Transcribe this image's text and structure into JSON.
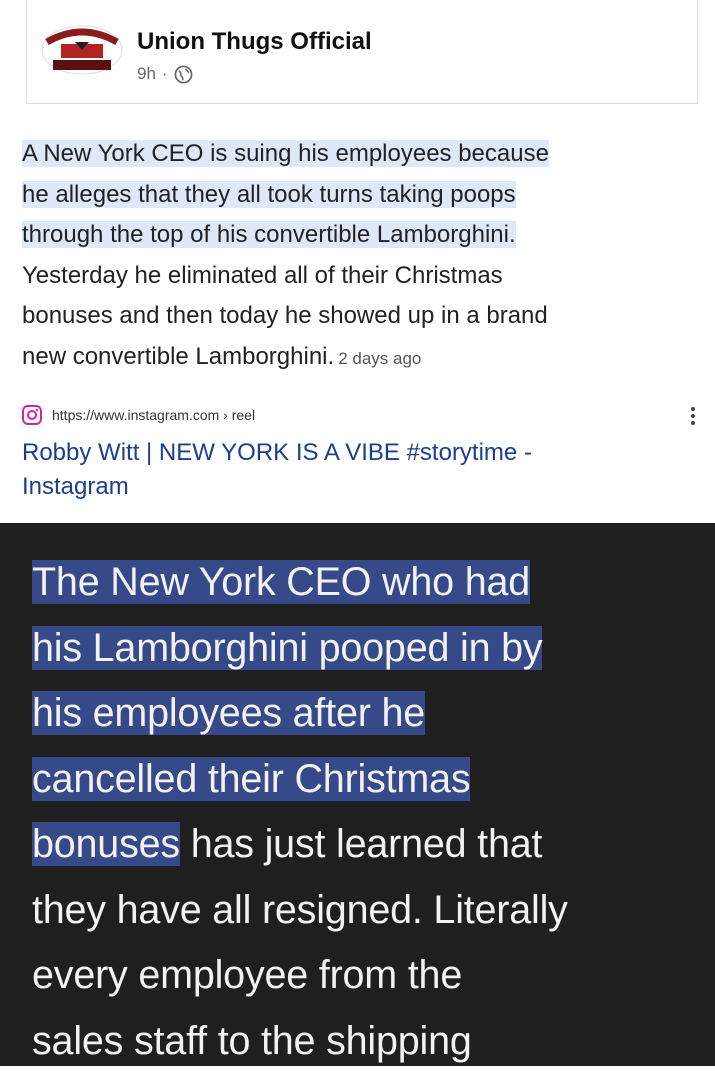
{
  "post": {
    "page_name": "Union Thugs Official",
    "time": "9h",
    "separator": "·",
    "avatar_logo_text": "UNION THUGS"
  },
  "snippet": {
    "lines": [
      "A New York CEO is suing his employees because",
      "he alleges that they all took turns taking poops",
      "through the top of his convertible Lamborghini.",
      "Yesterday he eliminated all of their Christmas",
      "bonuses and then today he showed up in a brand",
      "new convertible Lamborghini."
    ],
    "date": "2 days ago",
    "source_url": "https://www.instagram.com › reel",
    "result_title_line1": "Robby Witt | NEW YORK IS A VIBE #storytime -",
    "result_title_line2": "Instagram"
  },
  "dark_quote": {
    "lines_highlighted": [
      "The New York CEO who had",
      "his Lamborghini pooped in by",
      "his employees after he",
      "cancelled their Christmas",
      "bonuses"
    ],
    "line5_rest": " has just learned that",
    "lines_plain": [
      "they have all resigned. Literally",
      "every employee from the",
      "sales staff to the shipping"
    ]
  },
  "colors": {
    "highlight_light": "#dfe8f8",
    "highlight_dark": "#364a8a",
    "link_blue": "#1a3f8f",
    "dark_bg": "#1f1f1f"
  }
}
